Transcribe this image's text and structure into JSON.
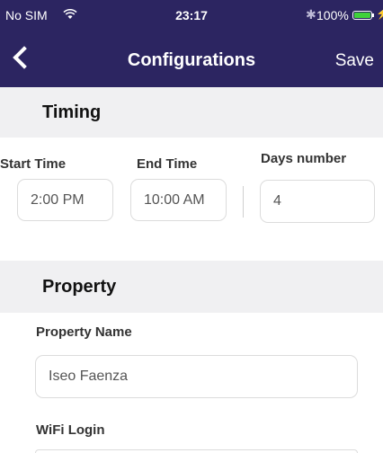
{
  "status_bar": {
    "carrier": "No SIM",
    "wifi_icon": "wifi-icon",
    "time": "23:17",
    "bluetooth_icon": "bluetooth-icon",
    "battery_percent": "100%",
    "battery_level": 1.0,
    "battery_color": "#3fd13b"
  },
  "nav": {
    "back_icon": "chevron-left-icon",
    "title": "Configurations",
    "save_label": "Save",
    "bar_color": "#2c2561"
  },
  "timing": {
    "header": "Timing",
    "start_time": {
      "label": "Start Time",
      "value": "2:00 PM"
    },
    "end_time": {
      "label": "End Time",
      "value": "10:00 AM"
    },
    "days_number": {
      "label": "Days number",
      "value": "4"
    }
  },
  "property": {
    "header": "Property",
    "name": {
      "label": "Property Name",
      "value": "Iseo Faenza"
    },
    "wifi_login": {
      "label": "WiFi Login",
      "value": ""
    }
  }
}
